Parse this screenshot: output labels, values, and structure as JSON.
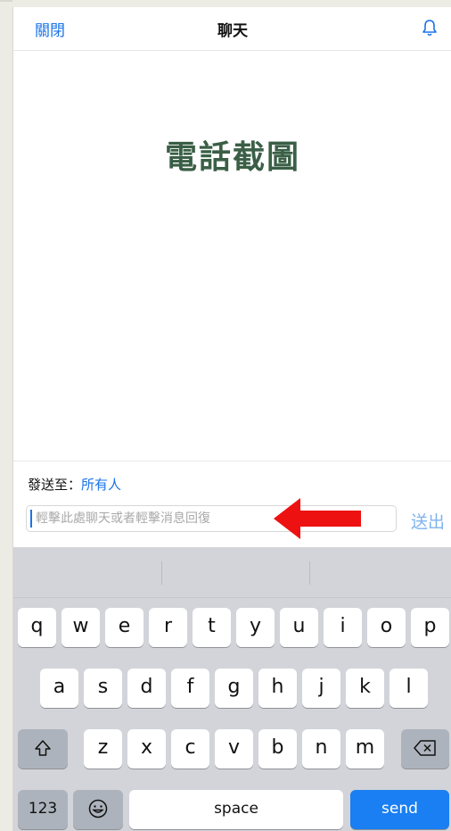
{
  "header": {
    "close_label": "關閉",
    "title": "聊天",
    "bell_icon": "bell-icon"
  },
  "overlay": {
    "title": "電話截圖"
  },
  "send_to": {
    "label": "發送至：",
    "target": "所有人"
  },
  "composer": {
    "placeholder": "輕擊此處聊天或者輕擊消息回復",
    "send_label": "送出"
  },
  "annotation": {
    "arrow_color": "#ee1111",
    "arrow_icon": "red-arrow-left-icon"
  },
  "keyboard": {
    "row1": [
      "q",
      "w",
      "e",
      "r",
      "t",
      "y",
      "u",
      "i",
      "o",
      "p"
    ],
    "row2": [
      "a",
      "s",
      "d",
      "f",
      "g",
      "h",
      "j",
      "k",
      "l"
    ],
    "row3": [
      "z",
      "x",
      "c",
      "v",
      "b",
      "n",
      "m"
    ],
    "shift_icon": "shift-icon",
    "backspace_icon": "backspace-icon",
    "emoji_icon": "emoji-icon",
    "numbers_label": "123",
    "space_label": "space",
    "send_label": "send"
  },
  "colors": {
    "accent": "#1a73e8",
    "send_key": "#1a7ff2",
    "overlay_text": "#3a5f46"
  }
}
